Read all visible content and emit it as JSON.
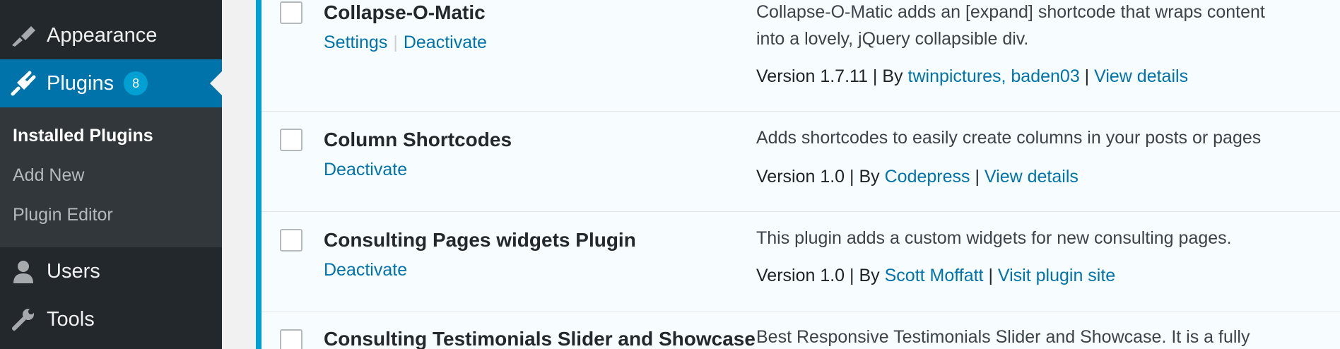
{
  "sidebar": {
    "appearance_label": "Appearance",
    "plugins_label": "Plugins",
    "plugins_badge": "8",
    "submenu": [
      "Installed Plugins",
      "Add New",
      "Plugin Editor"
    ],
    "users_label": "Users",
    "tools_label": "Tools"
  },
  "plugins": [
    {
      "name": "Collapse-O-Matic",
      "action1": "Settings",
      "action2": "Deactivate",
      "desc_line1": "Collapse-O-Matic adds an [expand] shortcode that wraps content",
      "desc_line2": "into a lovely, jQuery collapsible div.",
      "version": "Version 1.7.11",
      "by": "By",
      "author": "twinpictures, baden03",
      "link": "View details"
    },
    {
      "name": "Column Shortcodes",
      "action1": "Deactivate",
      "desc_line1": "Adds shortcodes to easily create columns in your posts or pages",
      "version": "Version 1.0",
      "by": "By",
      "author": "Codepress",
      "link": "View details"
    },
    {
      "name": "Consulting Pages widgets Plugin",
      "action1": "Deactivate",
      "desc_line1": "This plugin adds a custom widgets for new consulting pages.",
      "version": "Version 1.0",
      "by": "By",
      "author": "Scott Moffatt",
      "link": "Visit plugin site"
    },
    {
      "name": "Consulting Testimonials Slider and Showcase",
      "desc_line1": "Best Responsive Testimonials Slider and Showcase. It is a fully"
    }
  ],
  "colors": {
    "sidebar_bg": "#23282d",
    "active_bg": "#0073aa",
    "link": "#0073aa",
    "badge": "#00a0d2"
  }
}
